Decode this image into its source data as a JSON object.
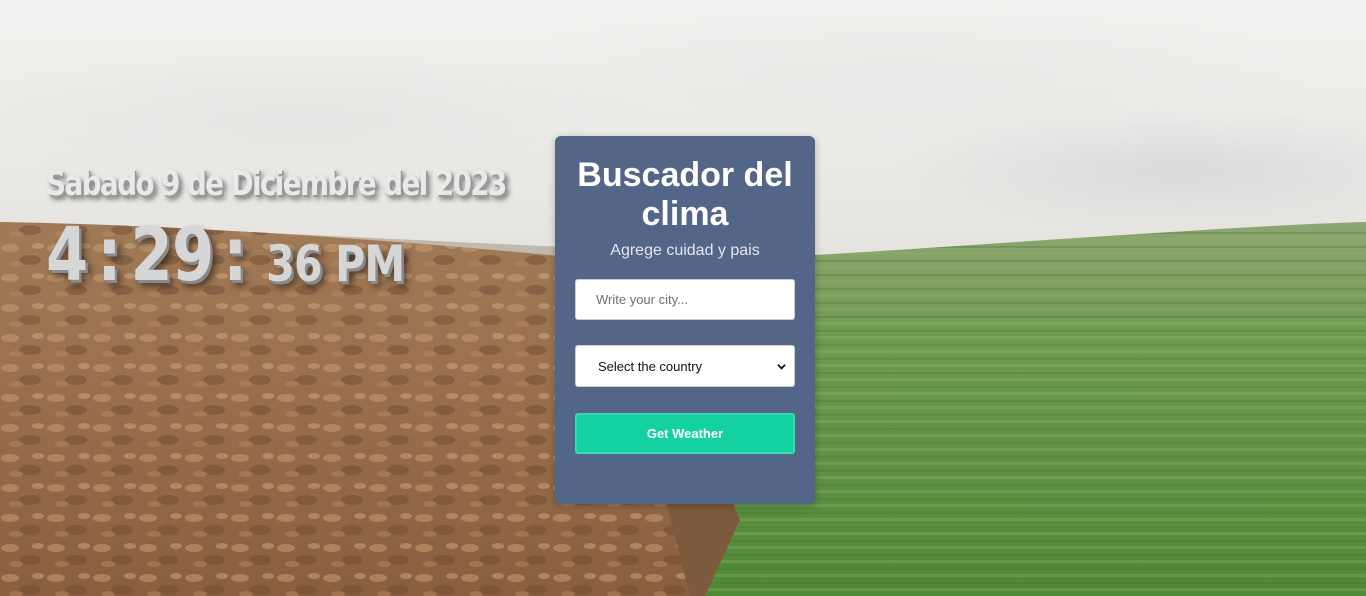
{
  "clock": {
    "date": "Sabado 9 de Diciembre del 2023",
    "hour": "4",
    "separator": ":",
    "minutes": "29",
    "seconds_period": "36 PM"
  },
  "weather_card": {
    "title": "Buscador del clima",
    "subtitle": "Agrege cuidad y pais",
    "city_input": {
      "value": "",
      "placeholder": "Write your city..."
    },
    "country_select": {
      "selected": "Select the country"
    },
    "submit_label": "Get Weather"
  },
  "colors": {
    "card_background": "#536688",
    "button_background": "#14d1a2",
    "button_border": "#38dcb0"
  },
  "icons": {
    "select_arrow": "chevron-down-icon"
  }
}
